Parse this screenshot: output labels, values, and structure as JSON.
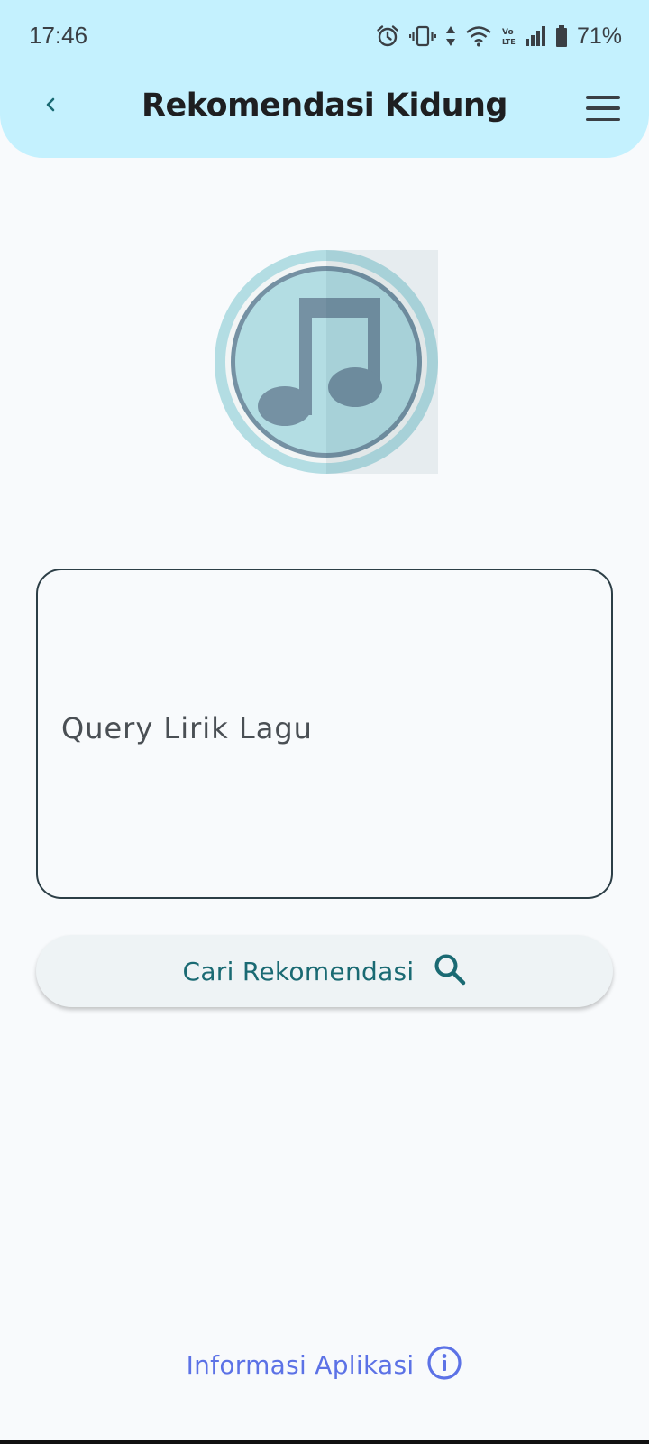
{
  "status_bar": {
    "time": "17:46",
    "battery": "71%",
    "icons": [
      "alarm-icon",
      "vibrate-icon",
      "data-arrows-icon",
      "wifi-icon",
      "volte-icon",
      "signal-icon",
      "battery-icon"
    ]
  },
  "header": {
    "title": "Rekomendasi Kidung",
    "back_icon": "chevron-left-icon",
    "menu_icon": "hamburger-menu-icon",
    "background": "#c4f1fe"
  },
  "logo": {
    "icon": "music-note-icon"
  },
  "query": {
    "placeholder": "Query Lirik Lagu",
    "value": ""
  },
  "search_button": {
    "label": "Cari Rekomendasi",
    "icon": "search-icon",
    "color": "#1a6a73"
  },
  "info_link": {
    "label": "Informasi Aplikasi",
    "icon": "info-icon",
    "color": "#5c72e6"
  }
}
